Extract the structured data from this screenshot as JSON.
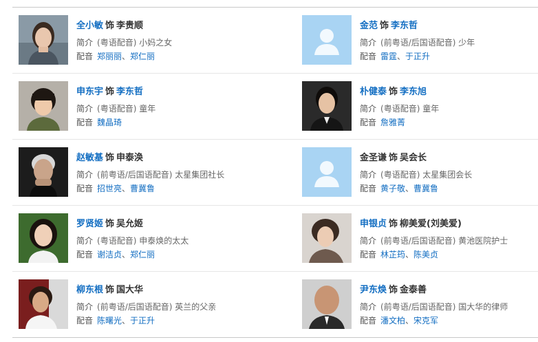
{
  "labels": {
    "intro": "简介",
    "voice": "配音",
    "as": "饰",
    "comma": "、"
  },
  "colors": {
    "link": "#136ec2",
    "text": "#333333",
    "muted": "#666666",
    "placeholder": "#a9d4f3"
  },
  "cast": [
    {
      "actor": "全小敏",
      "role": "李贵顺",
      "role_linked": false,
      "intro": "(粤语配音) 小妈之女",
      "voices": [
        "郑丽丽",
        "郑仁丽"
      ],
      "photo": "actor-photo"
    },
    {
      "actor": "金范",
      "role": "李东哲",
      "role_linked": true,
      "intro": "(前粤语/后国语配音) 少年",
      "voices": [
        "雷霆",
        "于正升"
      ],
      "photo": "placeholder-avatar"
    },
    {
      "actor": "申东宇",
      "role": "李东哲",
      "role_linked": true,
      "intro": "(粤语配音) 童年",
      "voices": [
        "魏晶琦"
      ],
      "photo": "actor-photo"
    },
    {
      "actor": "朴健泰",
      "role": "李东旭",
      "role_linked": true,
      "intro": "(粤语配音) 童年",
      "voices": [
        "詹雅菁"
      ],
      "photo": "actor-photo"
    },
    {
      "actor": "赵敏基",
      "role": "申泰涣",
      "role_linked": false,
      "intro": "(前粤语/后国语配音) 太星集团社长",
      "voices": [
        "招世亮",
        "曹冀鲁"
      ],
      "photo": "actor-photo"
    },
    {
      "actor": "金圣谦",
      "role": "吴会长",
      "role_linked": false,
      "intro": "(粤语配音) 太星集团会长",
      "voices": [
        "黄子敬",
        "曹冀鲁"
      ],
      "photo": "placeholder-avatar"
    },
    {
      "actor": "罗贤姬",
      "role": "吴允姬",
      "role_linked": false,
      "intro": "(粤语配音) 申泰焕的太太",
      "voices": [
        "谢洁贞",
        "郑仁丽"
      ],
      "photo": "actor-photo"
    },
    {
      "actor": "申银贞",
      "role": "柳美爱(刘美爱)",
      "role_linked": false,
      "intro": "(前粤语/后国语配音) 黄池医院护士",
      "voices": [
        "林芷筠",
        "陈美贞"
      ],
      "photo": "actor-photo"
    },
    {
      "actor": "柳东根",
      "role": "国大华",
      "role_linked": false,
      "intro": "(前粤语/后国语配音) 英兰的父亲",
      "voices": [
        "陈曙光",
        "于正升"
      ],
      "photo": "actor-photo"
    },
    {
      "actor": "尹东焕",
      "role": "金泰善",
      "role_linked": false,
      "intro": "(前粤语/后国语配音) 国大华的律师",
      "voices": [
        "潘文柏",
        "宋克军"
      ],
      "photo": "actor-photo"
    }
  ]
}
